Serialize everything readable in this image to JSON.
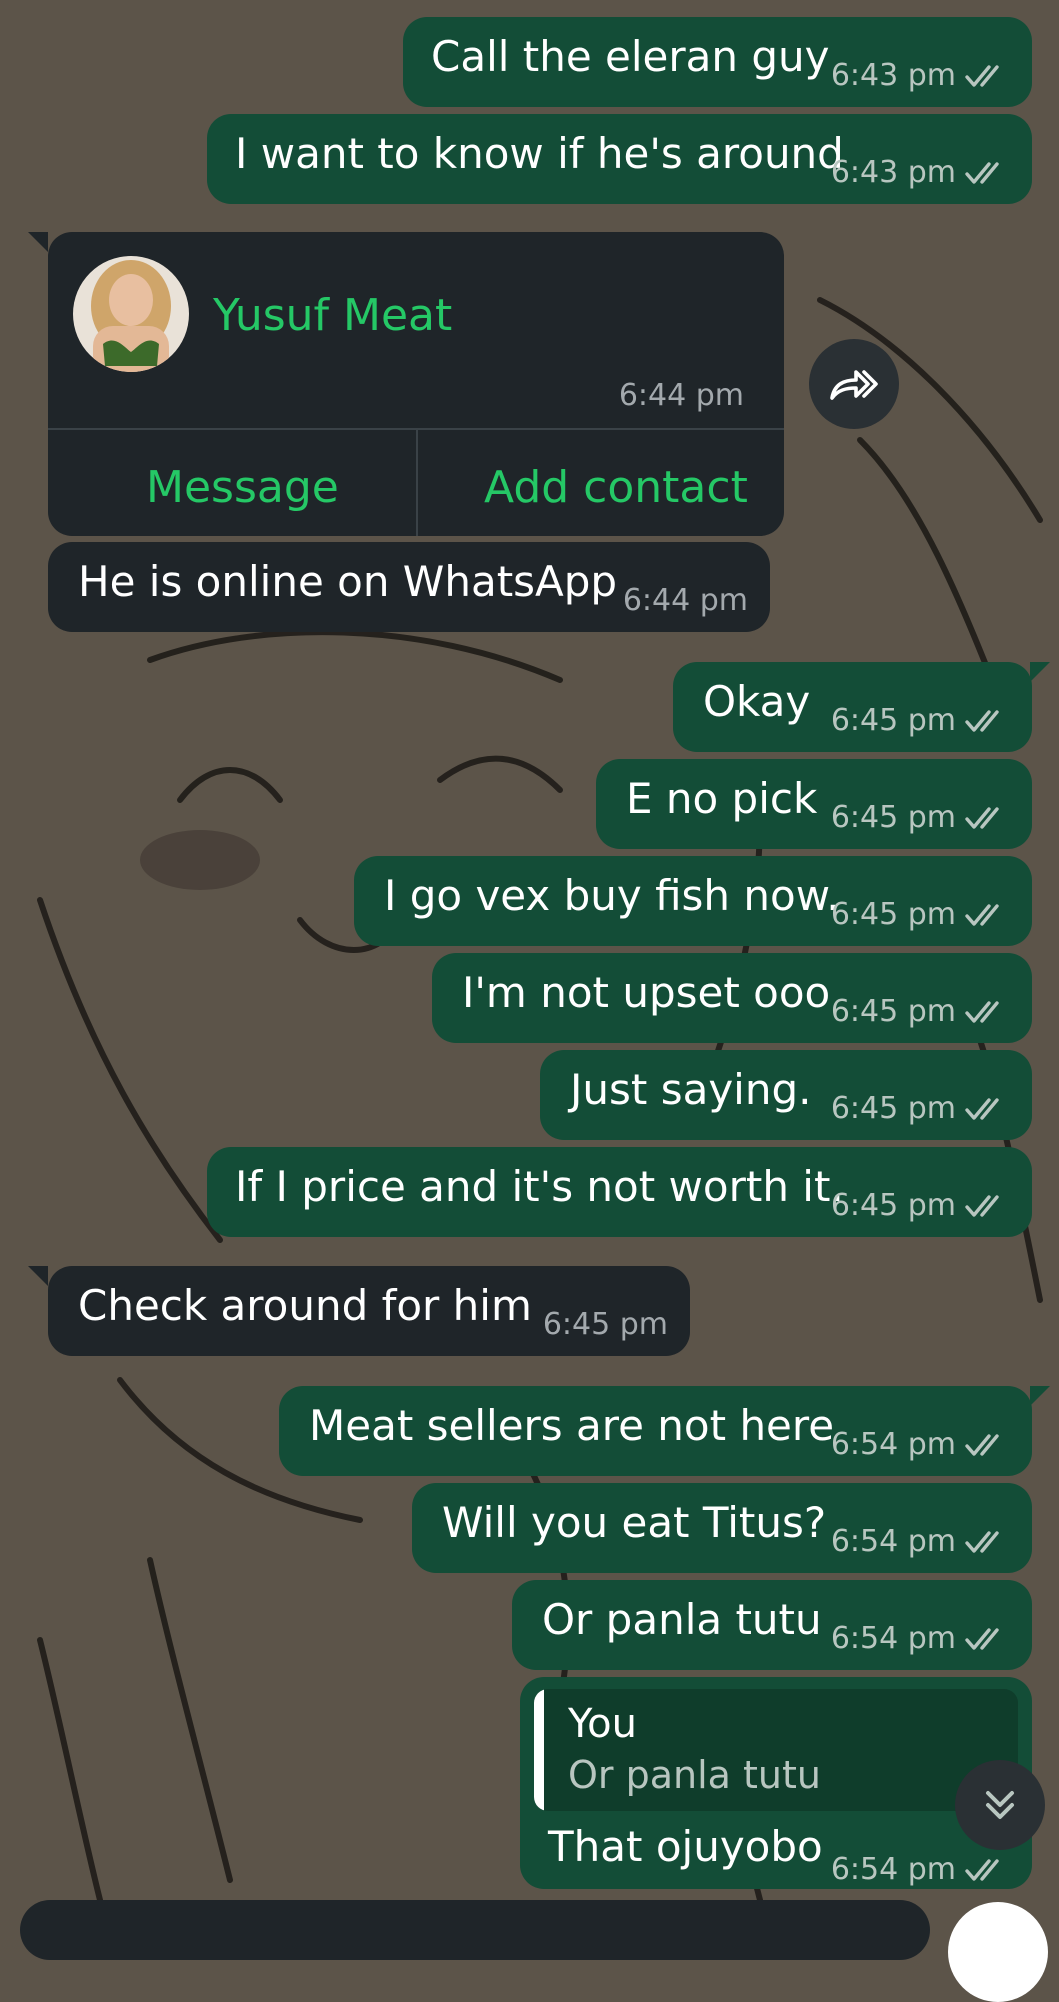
{
  "colors": {
    "outgoing_bubble": "#134d37",
    "incoming_bubble": "#1f2529",
    "accent_green": "#25c866",
    "read_tick": "#b8c6c0",
    "wallpaper": "#5c5449"
  },
  "messages": [
    {
      "dir": "out",
      "text": "Call the eleran guy",
      "time": "6:43 pm",
      "status": "read"
    },
    {
      "dir": "out",
      "text": "I want to know if he's around",
      "time": "6:43 pm",
      "status": "read"
    },
    {
      "dir": "in",
      "type": "contact_card",
      "name": "Yusuf Meat",
      "time": "6:44 pm",
      "actions": [
        "Message",
        "Add contact"
      ]
    },
    {
      "dir": "in",
      "text": "He is online on WhatsApp",
      "time": "6:44 pm"
    },
    {
      "dir": "out",
      "text": "Okay",
      "time": "6:45 pm",
      "status": "read"
    },
    {
      "dir": "out",
      "text": "E no pick",
      "time": "6:45 pm",
      "status": "read"
    },
    {
      "dir": "out",
      "text": "I go vex buy fish now.",
      "time": "6:45 pm",
      "status": "read"
    },
    {
      "dir": "out",
      "text": "I'm not upset ooo",
      "time": "6:45 pm",
      "status": "read"
    },
    {
      "dir": "out",
      "text": "Just saying.",
      "time": "6:45 pm",
      "status": "read"
    },
    {
      "dir": "out",
      "text": "If I price and it's not worth it.",
      "time": "6:45 pm",
      "status": "read"
    },
    {
      "dir": "in",
      "text": "Check around for him",
      "time": "6:45 pm"
    },
    {
      "dir": "out",
      "text": "Meat sellers are not here",
      "time": "6:54 pm",
      "status": "read"
    },
    {
      "dir": "out",
      "text": "Will you eat Titus?",
      "time": "6:54 pm",
      "status": "read"
    },
    {
      "dir": "out",
      "text": "Or panla tutu",
      "time": "6:54 pm",
      "status": "read"
    },
    {
      "dir": "out",
      "type": "reply",
      "quote_author": "You",
      "quote_text": "Or panla tutu",
      "text": "That ojuyobo",
      "time": "6:54 pm",
      "status": "read"
    }
  ],
  "icons": {
    "forward": "forward-icon",
    "read_receipt": "double-check-icon",
    "scroll_down": "double-chevron-down-icon"
  }
}
